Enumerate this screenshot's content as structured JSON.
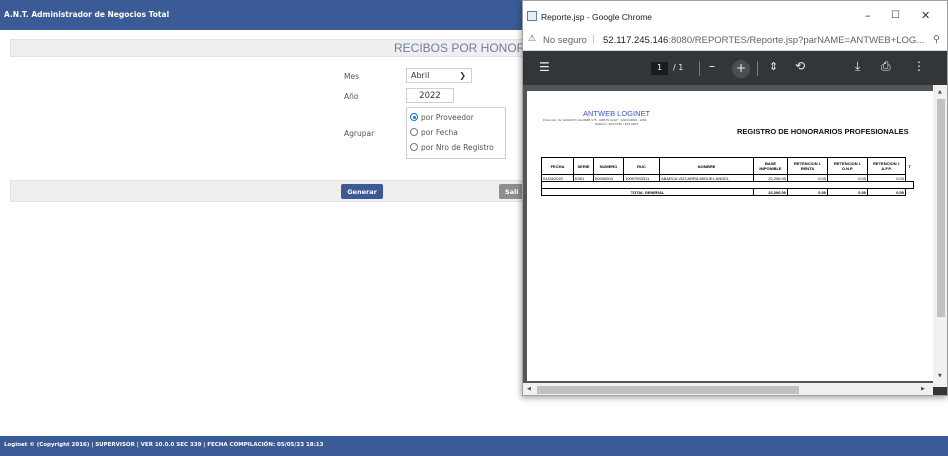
{
  "app": {
    "title": "A.N.T. Administrador de Negocios Total",
    "footer": "Loginet © (Copyright 2016) | SUPERVISOR | VER 10.0.0 SEC 339 | FECHA COMPILACIÓN: 05/05/23 18:13"
  },
  "form": {
    "title": "RECIBOS POR HONORA",
    "mes_label": "Mes",
    "mes_value": "Abril",
    "anio_label": "Año",
    "anio_value": "2022",
    "agrupar_label": "Agrupar",
    "options": [
      "por Proveedor",
      "por Fecha",
      "por Nro de Registro"
    ],
    "selected_option": "por Proveedor",
    "generar_label": "Generar",
    "salir_label": "Sali"
  },
  "chrome": {
    "window_title": "Reporte.jsp - Google Chrome",
    "not_secure": "No seguro",
    "url_host": "52.117.245.146",
    "url_rest": ":8080/REPORTES/Reporte.jsp?parNAME=ANTWEB+LOG...",
    "page_current": "1",
    "page_total": "/ 1",
    "icons": [
      "menu-icon",
      "zoom-out-icon",
      "zoom-in-icon",
      "fit-page-icon",
      "rotate-icon",
      "download-icon",
      "print-icon",
      "more-icon"
    ]
  },
  "report": {
    "company": "ANTWEB LOGINET",
    "address": "Dirección: AV. AUGUSTO AGUIRRE 175 - URB EL GOLF - SAN ISIDRO - LIMA",
    "phone": "Teléfono: 264-0746 / 264-0203",
    "title": "REGISTRO DE HONORARIOS PROFESIONALES",
    "columns": [
      "FECHA",
      "SERIE",
      "NUMERO",
      "RUC",
      "NOMBRE",
      "BASE IMPONIBLE",
      "RETENCION I. RENTA",
      "RETENCION I. O.N.P.",
      "RETENCION I. A.F.P.",
      "T"
    ],
    "rows": [
      [
        "01/04/2022",
        "E001",
        "00000004",
        "10097933311",
        "ABARCA VIZCARRA MIGUEL ANGEL",
        "22,206.00",
        "0.00",
        "0.00",
        "0.00",
        ""
      ]
    ],
    "total_label": "TOTAL GENERAL",
    "totals": [
      "22,206.00",
      "0.00",
      "0.00",
      "0.00"
    ]
  }
}
